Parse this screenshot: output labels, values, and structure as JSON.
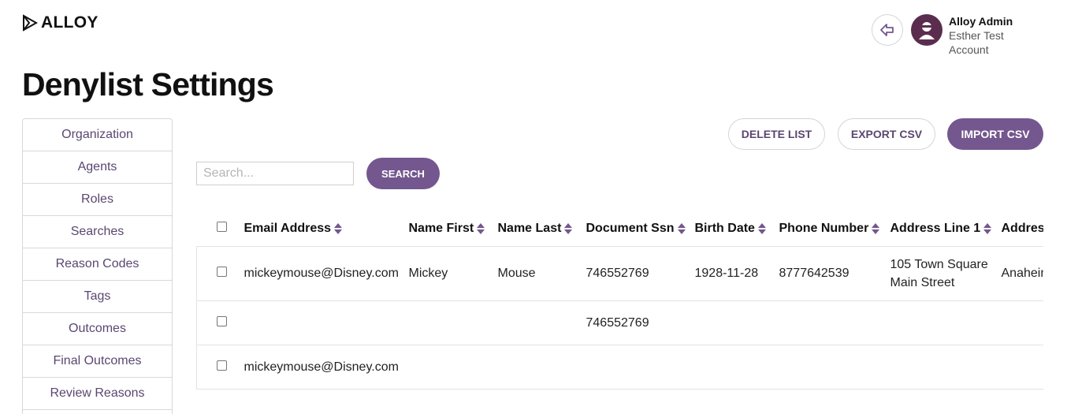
{
  "brand": {
    "name": "ALLOY",
    "accent": "#74578e",
    "text_accent": "#5b4670"
  },
  "user": {
    "name": "Alloy Admin",
    "account": "Esther Test Account"
  },
  "page": {
    "title": "Denylist Settings"
  },
  "sidebar": {
    "items": [
      {
        "label": "Organization"
      },
      {
        "label": "Agents"
      },
      {
        "label": "Roles"
      },
      {
        "label": "Searches"
      },
      {
        "label": "Reason Codes"
      },
      {
        "label": "Tags"
      },
      {
        "label": "Outcomes"
      },
      {
        "label": "Final Outcomes"
      },
      {
        "label": "Review Reasons"
      }
    ]
  },
  "actions": {
    "delete": "DELETE LIST",
    "export": "EXPORT CSV",
    "import": "IMPORT CSV"
  },
  "search": {
    "placeholder": "Search...",
    "value": "",
    "button": "SEARCH"
  },
  "table": {
    "columns": [
      "Email Address",
      "Name First",
      "Name Last",
      "Document Ssn",
      "Birth Date",
      "Phone Number",
      "Address Line 1",
      "Address"
    ],
    "rows": [
      {
        "email": "mickeymouse@Disney.com",
        "first": "Mickey",
        "last": "Mouse",
        "ssn": "746552769",
        "birth": "1928-11-28",
        "phone": "8777642539",
        "addr1": "105 Town Square Main Street",
        "addr2": "Anaheim"
      },
      {
        "email": "",
        "first": "",
        "last": "",
        "ssn": "746552769",
        "birth": "",
        "phone": "",
        "addr1": "",
        "addr2": ""
      },
      {
        "email": "mickeymouse@Disney.com",
        "first": "",
        "last": "",
        "ssn": "",
        "birth": "",
        "phone": "",
        "addr1": "",
        "addr2": ""
      }
    ]
  }
}
